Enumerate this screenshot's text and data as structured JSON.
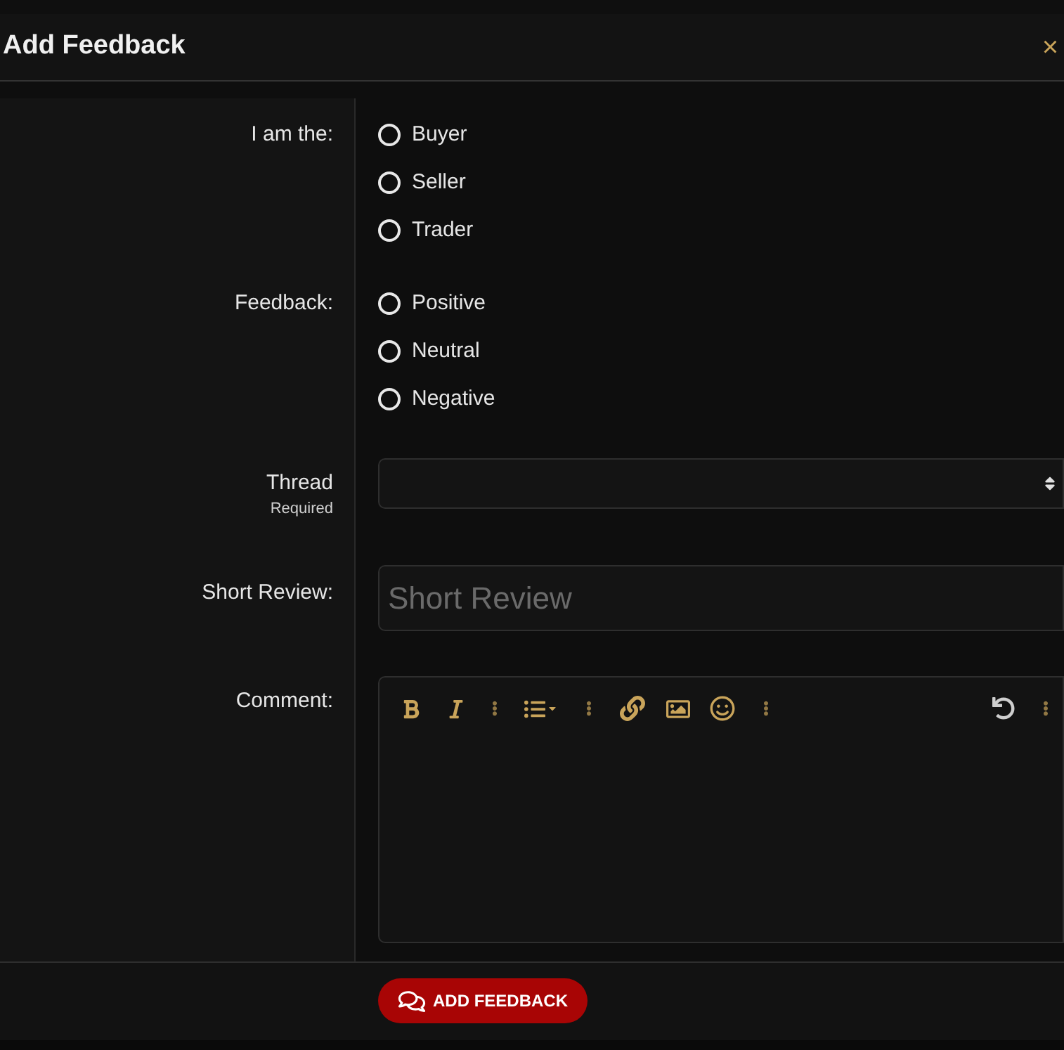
{
  "dialog": {
    "title": "Add Feedback",
    "close": "×"
  },
  "role": {
    "label": "I am the:",
    "options": [
      {
        "label": "Buyer",
        "selected": false
      },
      {
        "label": "Seller",
        "selected": false
      },
      {
        "label": "Trader",
        "selected": false
      }
    ]
  },
  "feedback": {
    "label": "Feedback:",
    "options": [
      {
        "label": "Positive",
        "selected": false
      },
      {
        "label": "Neutral",
        "selected": false
      },
      {
        "label": "Negative",
        "selected": false
      }
    ]
  },
  "thread": {
    "label": "Thread",
    "hint": "Required"
  },
  "short_review": {
    "label": "Short Review:",
    "placeholder": "Short Review"
  },
  "comment": {
    "label": "Comment:"
  },
  "submit": {
    "label": "ADD FEEDBACK"
  }
}
